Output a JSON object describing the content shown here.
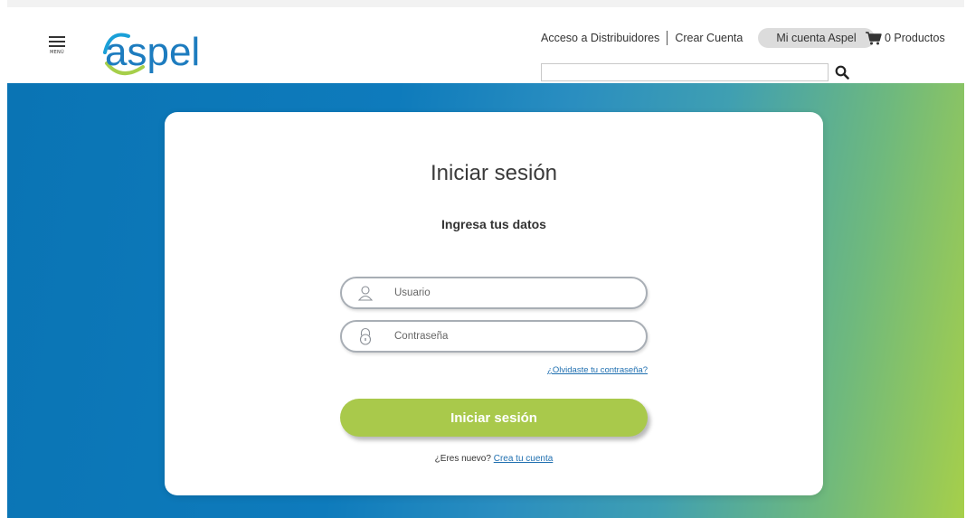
{
  "header": {
    "menu_label": "MENÚ",
    "logo_text": "aspel",
    "links": {
      "distribuidores": "Acceso a Distribuidores",
      "crear_cuenta": "Crear Cuenta",
      "mi_cuenta": "Mi cuenta Aspel"
    },
    "cart_label": "0 Productos",
    "search": {
      "value": "",
      "placeholder": ""
    }
  },
  "login": {
    "title": "Iniciar sesión",
    "subtitle": "Ingresa tus datos",
    "username_placeholder": "Usuario",
    "password_placeholder": "Contraseña",
    "forgot_label": "¿Olvidaste tu contraseña?",
    "submit_label": "Iniciar sesión",
    "new_user_prompt": "¿Eres nuevo?",
    "signup_link": "Crea tu cuenta"
  },
  "icons": {
    "menu": "hamburger-icon",
    "cart": "cart-icon",
    "search": "search-icon",
    "user": "user-icon",
    "lock": "lock-icon"
  },
  "colors": {
    "brand_blue": "#0a74b4",
    "brand_green": "#a6cf4a",
    "button_green": "#a9c94b",
    "link_blue": "#1f6fb0",
    "pill_gray": "#dcdcdc"
  }
}
